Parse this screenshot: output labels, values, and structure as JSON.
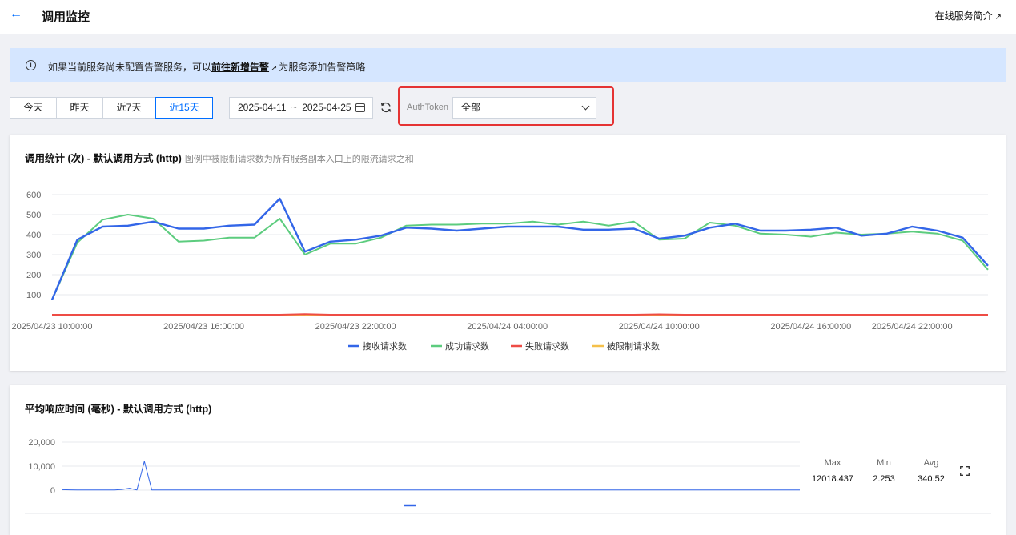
{
  "header": {
    "title": "调用监控",
    "intro_link": "在线服务简介"
  },
  "banner": {
    "text_before": "如果当前服务尚未配置告警服务，可以",
    "link": "前往新增告警",
    "text_after": "为服务添加告警策略"
  },
  "filters": {
    "ranges": [
      {
        "label": "今天",
        "active": false
      },
      {
        "label": "昨天",
        "active": false
      },
      {
        "label": "近7天",
        "active": false
      },
      {
        "label": "近15天",
        "active": true
      }
    ],
    "date_start": "2025-04-11",
    "date_sep": "~",
    "date_end": "2025-04-25",
    "auth_label": "AuthToken",
    "auth_value": "全部"
  },
  "colors": {
    "accent": "#006eff",
    "received": "#3366e8",
    "success": "#5ccc7e",
    "failed": "#ee4c45",
    "throttled": "#f5c04a",
    "highlight": "#e53333"
  },
  "chart1": {
    "title": "调用统计 (次) - 默认调用方式 (http)",
    "subtitle": "图例中被限制请求数为所有服务副本入口上的限流请求之和"
  },
  "chart2": {
    "title": "平均响应时间 (毫秒) - 默认调用方式 (http)",
    "stats": [
      {
        "label": "Max",
        "value": "12018.437"
      },
      {
        "label": "Min",
        "value": "2.253"
      },
      {
        "label": "Avg",
        "value": "340.52"
      }
    ]
  },
  "chart_data": [
    {
      "type": "line",
      "title": "调用统计 (次) - 默认调用方式 (http)",
      "ylim": [
        0,
        600
      ],
      "yticks": [
        100,
        200,
        300,
        400,
        500,
        600
      ],
      "x_tick_labels": [
        "2025/04/23 10:00:00",
        "2025/04/23 16:00:00",
        "2025/04/23 22:00:00",
        "2025/04/24 04:00:00",
        "2025/04/24 10:00:00",
        "2025/04/24 16:00:00",
        "2025/04/24 22:00:00"
      ],
      "x_ticks_at_index": [
        0,
        6,
        12,
        18,
        24,
        30,
        34
      ],
      "legend": "bottom",
      "series": [
        {
          "name": "接收请求数",
          "color": "#3366e8",
          "values": [
            75,
            375,
            440,
            445,
            465,
            430,
            430,
            445,
            450,
            580,
            315,
            365,
            375,
            395,
            435,
            430,
            420,
            430,
            440,
            440,
            440,
            425,
            425,
            430,
            380,
            395,
            435,
            455,
            420,
            420,
            425,
            435,
            395,
            405,
            440,
            420,
            385,
            245
          ]
        },
        {
          "name": "成功请求数",
          "color": "#5ccc7e",
          "values": [
            75,
            360,
            475,
            500,
            480,
            365,
            370,
            385,
            385,
            480,
            300,
            355,
            355,
            385,
            445,
            450,
            450,
            455,
            455,
            465,
            450,
            465,
            445,
            465,
            375,
            380,
            460,
            445,
            405,
            400,
            390,
            410,
            400,
            405,
            415,
            405,
            370,
            225
          ]
        },
        {
          "name": "失败请求数",
          "color": "#ee4c45",
          "values": [
            0,
            0,
            0,
            0,
            0,
            0,
            0,
            0,
            0,
            0,
            3,
            0,
            0,
            0,
            0,
            0,
            0,
            0,
            0,
            0,
            0,
            0,
            0,
            0,
            2,
            0,
            0,
            0,
            0,
            0,
            0,
            0,
            0,
            0,
            0,
            0,
            0,
            0
          ]
        },
        {
          "name": "被限制请求数",
          "color": "#f5c04a",
          "values": [
            0,
            0,
            0,
            0,
            0,
            0,
            0,
            0,
            0,
            0,
            0,
            0,
            0,
            0,
            0,
            0,
            0,
            0,
            0,
            0,
            0,
            0,
            0,
            0,
            0,
            0,
            0,
            0,
            0,
            0,
            0,
            0,
            0,
            0,
            0,
            0,
            0,
            0
          ]
        }
      ]
    },
    {
      "type": "line",
      "title": "平均响应时间 (毫秒) - 默认调用方式 (http)",
      "ylim": [
        -1000,
        22000
      ],
      "yticks": [
        0,
        10000,
        20000
      ],
      "ytick_labels": [
        "0",
        "10,000",
        "20,000"
      ],
      "series": [
        {
          "color": "#3366e8",
          "values": [
            200,
            120,
            100,
            90,
            80,
            80,
            80,
            80,
            300,
            800,
            80,
            12018,
            80,
            80,
            80,
            80,
            80,
            80,
            80,
            80,
            80,
            80,
            80,
            80,
            80,
            80,
            80,
            80,
            80,
            80,
            80,
            80,
            80,
            80,
            80,
            80,
            80,
            80,
            80,
            80,
            80,
            80,
            80,
            80,
            80,
            80,
            80,
            80,
            80,
            80,
            80,
            80,
            80,
            80,
            80,
            80,
            80,
            80,
            80,
            80,
            80,
            80,
            80,
            80,
            80,
            80,
            80,
            80,
            80,
            80,
            80,
            80,
            80,
            80,
            80,
            80,
            80,
            80,
            80,
            80,
            80,
            80,
            80,
            80,
            80,
            80,
            80,
            80,
            80,
            80,
            80,
            80,
            80,
            80,
            80,
            80,
            80,
            80,
            80,
            80
          ]
        }
      ]
    }
  ]
}
